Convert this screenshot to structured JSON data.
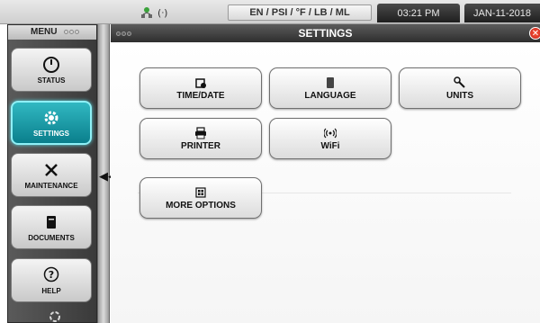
{
  "topbar": {
    "units": "EN / PSI / °F / LB / ML",
    "time": "03:21 PM",
    "date": "JAN-11-2018",
    "signal_glyph": "(ᐧ)"
  },
  "menu": {
    "title": "MENU",
    "items": [
      {
        "label": "STATUS",
        "icon": "gauge-icon",
        "active": false
      },
      {
        "label": "SETTINGS",
        "icon": "gear-icon",
        "active": true
      },
      {
        "label": "MAINTENANCE",
        "icon": "tools-icon",
        "active": false
      },
      {
        "label": "DOCUMENTS",
        "icon": "document-icon",
        "active": false
      },
      {
        "label": "HELP",
        "icon": "help-icon",
        "active": false
      }
    ],
    "collapse_glyph": "◀◀"
  },
  "settings": {
    "title": "SETTINGS",
    "close_glyph": "✕",
    "buttons": [
      {
        "label": "TIME/DATE",
        "icon": "calendar-icon"
      },
      {
        "label": "LANGUAGE",
        "icon": "book-icon"
      },
      {
        "label": "UNITS",
        "icon": "wrench-icon"
      },
      {
        "label": "PRINTER",
        "icon": "printer-icon"
      },
      {
        "label": "WiFi",
        "icon": "wifi-icon"
      },
      {
        "label": "MORE OPTIONS",
        "icon": "grid-icon"
      }
    ]
  },
  "colors": {
    "accent_active": "#0a7f8c",
    "close": "#c0201a"
  }
}
